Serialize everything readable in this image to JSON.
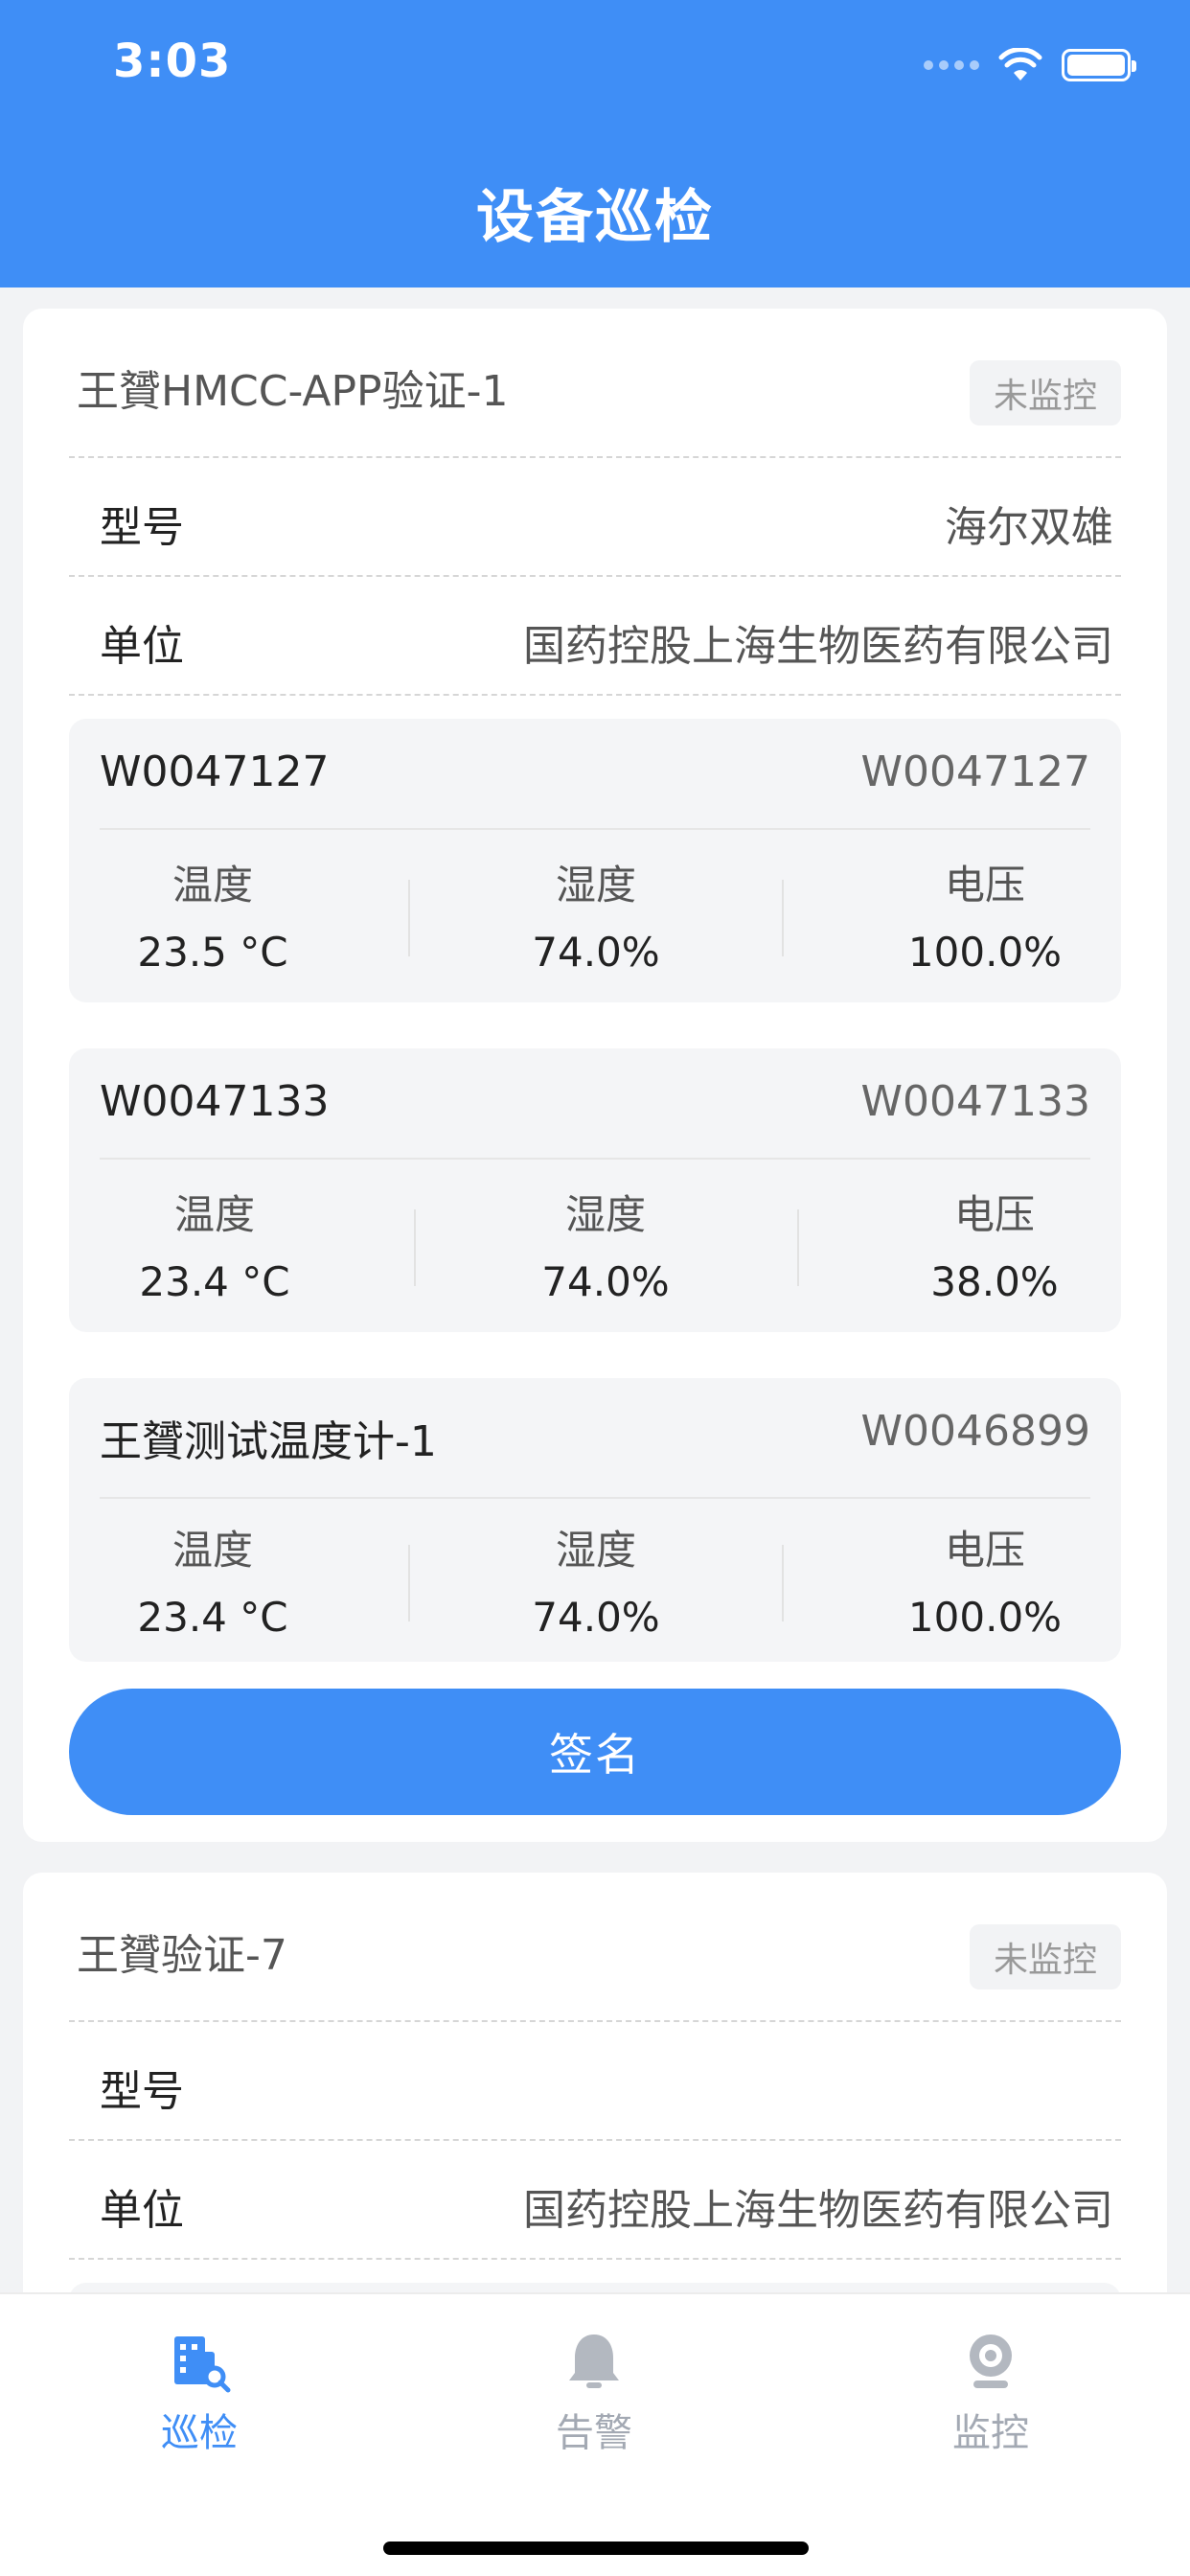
{
  "status_bar": {
    "time": "3:03"
  },
  "header": {
    "title": "设备巡检"
  },
  "colors": {
    "accent": "#3f8ef6",
    "inactive_tab": "#a3a9b3"
  },
  "cards": [
    {
      "device_name": "王贇HMCC-APP验证-1",
      "status_badge": "未监控",
      "model_label": "型号",
      "model_value": "海尔双雄",
      "unit_label": "单位",
      "unit_value": "国药控股上海生物医药有限公司",
      "sensors": [
        {
          "name": "W0047127",
          "code": "W0047127",
          "metrics": [
            {
              "label": "温度",
              "value": "23.5 °C"
            },
            {
              "label": "湿度",
              "value": "74.0%"
            },
            {
              "label": "电压",
              "value": "100.0%"
            }
          ]
        },
        {
          "name": "W0047133",
          "code": "W0047133",
          "metrics": [
            {
              "label": "温度",
              "value": "23.4 °C"
            },
            {
              "label": "湿度",
              "value": "74.0%"
            },
            {
              "label": "电压",
              "value": "38.0%"
            }
          ]
        },
        {
          "name": "王贇测试温度计-1",
          "code": "W0046899",
          "metrics": [
            {
              "label": "温度",
              "value": "23.4 °C"
            },
            {
              "label": "湿度",
              "value": "74.0%"
            },
            {
              "label": "电压",
              "value": "100.0%"
            }
          ]
        }
      ],
      "sign_button": "签名"
    },
    {
      "device_name": "王贇验证-7",
      "status_badge": "未监控",
      "model_label": "型号",
      "model_value": "",
      "unit_label": "单位",
      "unit_value": "国药控股上海生物医药有限公司"
    }
  ],
  "tabbar": {
    "tabs": [
      {
        "label": "巡检",
        "icon": "building-search-icon",
        "active": true
      },
      {
        "label": "告警",
        "icon": "bell-icon",
        "active": false
      },
      {
        "label": "监控",
        "icon": "camera-icon",
        "active": false
      }
    ]
  }
}
